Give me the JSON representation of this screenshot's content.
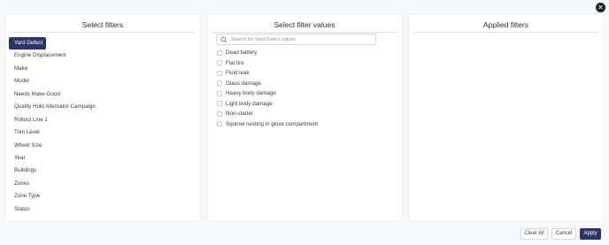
{
  "close_icon": "close-icon",
  "panels": {
    "select_filters": {
      "title": "Select filters",
      "items": [
        {
          "label": "Yard Defect",
          "selected": true
        },
        {
          "label": "Engine Displacement"
        },
        {
          "label": "Make"
        },
        {
          "label": "Model"
        },
        {
          "label": "Needs Make-Good"
        },
        {
          "label": "Quality Hold Alternator Campaign"
        },
        {
          "label": "Rollout Line 1"
        },
        {
          "label": "Trim Level"
        },
        {
          "label": "Wheel Size"
        },
        {
          "label": "Year"
        },
        {
          "label": "Buildings"
        },
        {
          "label": "Zones"
        },
        {
          "label": "Zone Type"
        },
        {
          "label": "Status"
        }
      ]
    },
    "select_values": {
      "title": "Select filter values",
      "search_placeholder": "Search for Yard Defect values",
      "search_icon": "search-icon",
      "values": [
        {
          "label": "Dead battery",
          "checked": false
        },
        {
          "label": "Flat tire",
          "checked": false
        },
        {
          "label": "Fluid leak",
          "checked": false
        },
        {
          "label": "Glass damage",
          "checked": false
        },
        {
          "label": "Heavy body damage",
          "checked": false
        },
        {
          "label": "Light body damage",
          "checked": false
        },
        {
          "label": "Non-starter",
          "checked": false
        },
        {
          "label": "Squirrel nesting in glove compartment",
          "checked": false
        }
      ]
    },
    "applied": {
      "title": "Applied filters"
    }
  },
  "footer": {
    "clear_all": "Clear All",
    "cancel": "Cancel",
    "apply": "Apply"
  },
  "colors": {
    "primary": "#2c3566",
    "background": "#f7f8fa"
  }
}
